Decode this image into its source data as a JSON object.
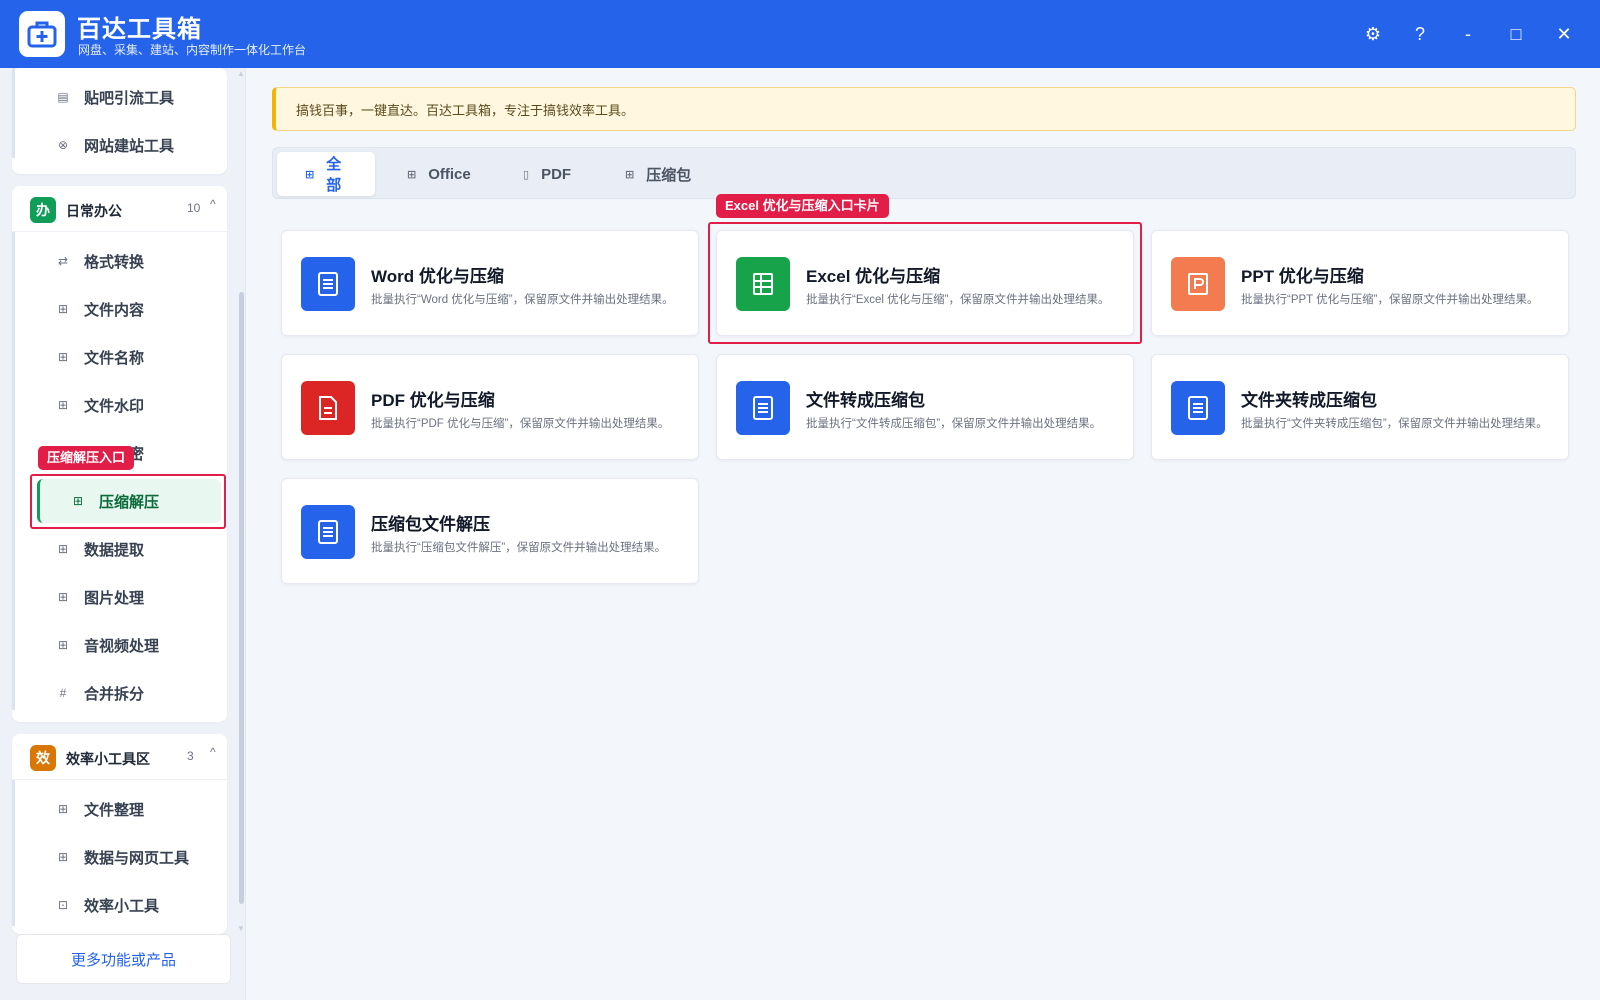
{
  "app": {
    "title": "百达工具箱",
    "subtitle": "网盘、采集、建站、内容制作一体化工作台",
    "brand_color": "#2563eb"
  },
  "window_controls": {
    "settings_icon": "⚙",
    "help_icon": "?",
    "minimize_icon": "-",
    "maximize_icon": "□",
    "close_icon": "✕"
  },
  "sidebar": {
    "top_group": {
      "items": [
        {
          "label": "贴吧引流工具",
          "icon": "doc-icon"
        },
        {
          "label": "网站建站工具",
          "icon": "globe-icon"
        }
      ]
    },
    "office_group": {
      "badge": "办",
      "badge_color": "#0f9d58",
      "title": "日常办公",
      "count": "10",
      "caret": "^",
      "items": [
        {
          "label": "格式转换",
          "icon": "swap-icon"
        },
        {
          "label": "文件内容",
          "icon": "grid-icon"
        },
        {
          "label": "文件名称",
          "icon": "grid-icon"
        },
        {
          "label": "文件水印",
          "icon": "grid-icon"
        },
        {
          "label": "文件加密",
          "icon": "grid-icon"
        },
        {
          "label": "压缩解压",
          "icon": "grid-icon",
          "active": true
        },
        {
          "label": "数据提取",
          "icon": "grid-icon"
        },
        {
          "label": "图片处理",
          "icon": "grid-icon"
        },
        {
          "label": "音视频处理",
          "icon": "grid-icon"
        },
        {
          "label": "合并拆分",
          "icon": "hash-icon"
        }
      ]
    },
    "efficiency_group": {
      "badge": "效",
      "badge_color": "#d97706",
      "title": "效率小工具区",
      "count": "3",
      "caret": "^",
      "items": [
        {
          "label": "文件整理",
          "icon": "grid-icon"
        },
        {
          "label": "数据与网页工具",
          "icon": "grid-icon"
        },
        {
          "label": "效率小工具",
          "icon": "toolbox-icon"
        }
      ]
    },
    "more_button": "更多功能或产品"
  },
  "callouts": {
    "sidebar": "压缩解压入口",
    "card": "Excel 优化与压缩入口卡片",
    "color": "#e11d48"
  },
  "notice": "搞钱百事，一键直达。百达工具箱，专注于搞钱效率工具。",
  "tabs": [
    {
      "label": "全部",
      "active": true
    },
    {
      "label": "Office"
    },
    {
      "label": "PDF"
    },
    {
      "label": "压缩包"
    }
  ],
  "cards": [
    {
      "title": "Word 优化与压缩",
      "desc": "批量执行“Word 优化与压缩”，保留原文件并输出处理结果。",
      "icon": "document-icon",
      "color": "#2563eb"
    },
    {
      "title": "Excel 优化与压缩",
      "desc": "批量执行“Excel 优化与压缩”，保留原文件并输出处理结果。",
      "icon": "spreadsheet-icon",
      "color": "#16a34a"
    },
    {
      "title": "PPT 优化与压缩",
      "desc": "批量执行“PPT 优化与压缩”，保留原文件并输出处理结果。",
      "icon": "presentation-icon",
      "color": "#f47a4f"
    },
    {
      "title": "PDF 优化与压缩",
      "desc": "批量执行“PDF 优化与压缩”，保留原文件并输出处理结果。",
      "icon": "pdf-icon",
      "color": "#dc2626"
    },
    {
      "title": "文件转成压缩包",
      "desc": "批量执行“文件转成压缩包”，保留原文件并输出处理结果。",
      "icon": "document-icon",
      "color": "#2563eb"
    },
    {
      "title": "文件夹转成压缩包",
      "desc": "批量执行“文件夹转成压缩包”，保留原文件并输出处理结果。",
      "icon": "document-icon",
      "color": "#2563eb"
    },
    {
      "title": "压缩包文件解压",
      "desc": "批量执行“压缩包文件解压”，保留原文件并输出处理结果。",
      "icon": "document-icon",
      "color": "#2563eb"
    }
  ]
}
